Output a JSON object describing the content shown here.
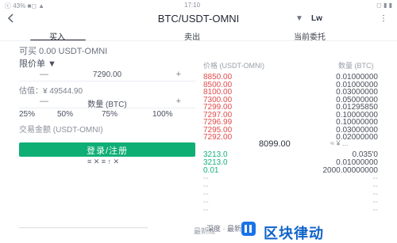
{
  "status_bar": {
    "left": "ⓒ 43% ■◻ ▲",
    "time": "17:10",
    "right": "◻ ▮ ▮"
  },
  "nav": {
    "title": "BTC/USDT-OMNI",
    "caret": "▼",
    "chart_button": "Lw",
    "more": "⋮"
  },
  "tabs": [
    {
      "label": "买入",
      "active": true
    },
    {
      "label": "卖出",
      "active": false
    },
    {
      "label": "当前委托",
      "active": false
    }
  ],
  "buy_label": "可买 0.00 USDT-OMNI",
  "price_label": "限价单 ▼",
  "price_stepper": {
    "minus": "—",
    "value": "7290.00",
    "plus": "+"
  },
  "valuation": "估值：¥ 49544.90",
  "amount_stepper": {
    "minus": "—",
    "value": "数量 (BTC)",
    "plus": "+"
  },
  "percent_options": [
    "25%",
    "50%",
    "75%",
    "100%"
  ],
  "trade_amount": "交易金额 (USDT-OMNI)",
  "buy_button": "登录/注册",
  "subline": "≡ ✕ ≡ ↑ ✕",
  "orderbook": {
    "col_price": "价格 (USDT-OMNI)",
    "col_qty": "数量 (BTC)",
    "asks": [
      {
        "price": "8850.00",
        "qty": "0.01000000"
      },
      {
        "price": "8500.00",
        "qty": "0.01000000"
      },
      {
        "price": "8100.00",
        "qty": "0.03000000"
      },
      {
        "price": "7300.00",
        "qty": "0.05000000"
      },
      {
        "price": "7299.00",
        "qty": "0.01295850"
      },
      {
        "price": "7297.00",
        "qty": "0.10000000"
      },
      {
        "price": "7296.99",
        "qty": "0.10000000"
      },
      {
        "price": "7295.00",
        "qty": "0.03000000"
      },
      {
        "price": "7292.00",
        "qty": "0.02000000"
      }
    ],
    "mid_price": "8099.00",
    "mid_fx": "≈ ¥ ...",
    "bids": [
      {
        "price": "3213.0",
        "qty": "0.035'0"
      },
      {
        "price": "3213.0",
        "qty": "0.01000000"
      },
      {
        "price": "0.01",
        "qty": "2000.00000000"
      },
      {
        "price": "--",
        "qty": "--"
      },
      {
        "price": "--",
        "qty": "--"
      },
      {
        "price": "--",
        "qty": "--"
      },
      {
        "price": "--",
        "qty": "--"
      },
      {
        "price": "--",
        "qty": "--"
      }
    ]
  },
  "bottom": {
    "faded_text": "——————————————————",
    "edge_text": "最新成",
    "logo_sub": "深度 · 最新成交",
    "logo_cn": "区块律动"
  }
}
